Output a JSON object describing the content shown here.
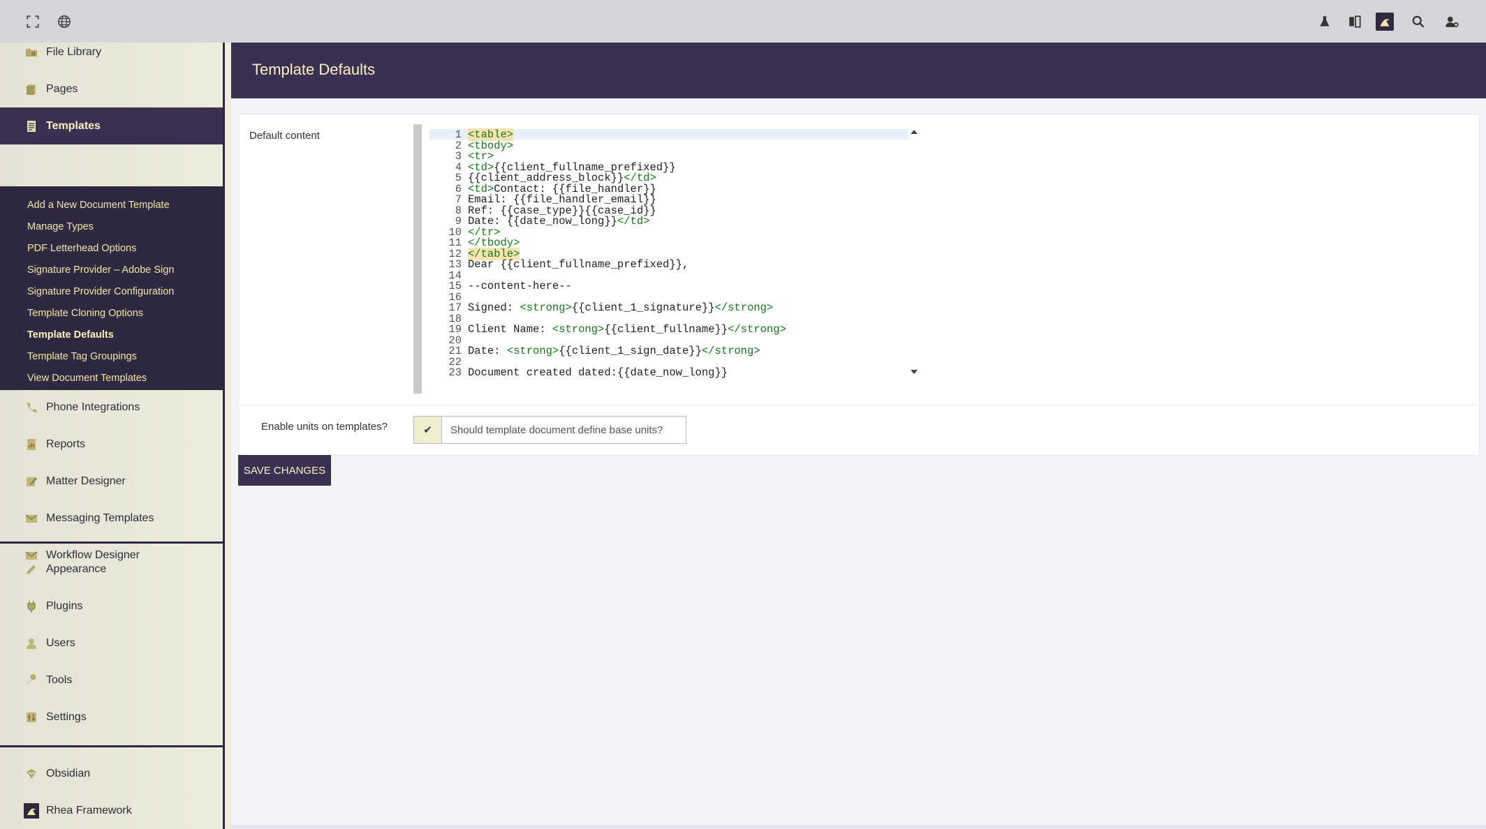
{
  "page_title": "Template Defaults",
  "topbar": {
    "left_icons": [
      "fullscreen-icon",
      "globe-icon"
    ],
    "right_icons": [
      "flask-icon",
      "book-icon",
      "rhea-logo-icon",
      "search-icon",
      "user-settings-icon"
    ]
  },
  "sidebar": {
    "items_top": [
      {
        "label": "File Library",
        "icon": "folder-icon"
      },
      {
        "label": "Pages",
        "icon": "pages-icon"
      },
      {
        "label": "Templates",
        "icon": "document-icon"
      }
    ],
    "submenu": [
      "Add a New Document Template",
      "Manage Types",
      "PDF Letterhead Options",
      "Signature Provider – Adobe Sign",
      "Signature Provider Configuration",
      "Template Cloning Options",
      "Template Defaults",
      "Template Tag Groupings",
      "View Document Templates"
    ],
    "items_mid": [
      {
        "label": "Phone Integrations",
        "icon": "phone-icon"
      },
      {
        "label": "Reports",
        "icon": "report-icon"
      },
      {
        "label": "Matter Designer",
        "icon": "edit-icon"
      },
      {
        "label": "Messaging Templates",
        "icon": "mail-icon"
      },
      {
        "label": "Workflow Designer",
        "icon": "mail-icon"
      }
    ],
    "items_admin": [
      {
        "label": "Appearance",
        "icon": "brush-icon"
      },
      {
        "label": "Plugins",
        "icon": "plug-icon"
      },
      {
        "label": "Users",
        "icon": "user-icon"
      },
      {
        "label": "Tools",
        "icon": "wrench-icon"
      },
      {
        "label": "Settings",
        "icon": "sliders-icon"
      }
    ],
    "items_bottom": [
      {
        "label": "Obsidian",
        "icon": "obsidian-icon"
      },
      {
        "label": "Rhea Framework",
        "icon": "rhea-logo-icon"
      }
    ]
  },
  "form": {
    "default_content_label": "Default content",
    "code_lines": [
      [
        {
          "t": "<table>",
          "c": "tag match"
        }
      ],
      [
        {
          "t": "<tbody>",
          "c": "tag"
        }
      ],
      [
        {
          "t": "<tr>",
          "c": "tag"
        }
      ],
      [
        {
          "t": "<td>",
          "c": "tag"
        },
        {
          "t": "{{client_fullname_prefixed}}"
        }
      ],
      [
        {
          "t": "{{client_address_block}}"
        },
        {
          "t": "</td>",
          "c": "tag"
        }
      ],
      [
        {
          "t": "<td>",
          "c": "tag"
        },
        {
          "t": "Contact: {{file_handler}}"
        }
      ],
      [
        {
          "t": "Email: {{file_handler_email}}"
        }
      ],
      [
        {
          "t": "Ref: {{case_type}}{{case_id}}"
        }
      ],
      [
        {
          "t": "Date: {{date_now_long}}"
        },
        {
          "t": "</td>",
          "c": "tag"
        }
      ],
      [
        {
          "t": "</tr>",
          "c": "tag"
        }
      ],
      [
        {
          "t": "</tbody>",
          "c": "tag"
        }
      ],
      [
        {
          "t": "</table>",
          "c": "tag match"
        }
      ],
      [
        {
          "t": "Dear {{client_fullname_prefixed}},"
        }
      ],
      [],
      [
        {
          "t": "--content-here--"
        }
      ],
      [],
      [
        {
          "t": "Signed: "
        },
        {
          "t": "<strong>",
          "c": "tag"
        },
        {
          "t": "{{client_1_signature}}"
        },
        {
          "t": "</strong>",
          "c": "tag"
        }
      ],
      [],
      [
        {
          "t": "Client Name: "
        },
        {
          "t": "<strong>",
          "c": "tag"
        },
        {
          "t": "{{client_fullname}}"
        },
        {
          "t": "</strong>",
          "c": "tag"
        }
      ],
      [],
      [
        {
          "t": "Date: "
        },
        {
          "t": "<strong>",
          "c": "tag"
        },
        {
          "t": "{{client_1_sign_date}}"
        },
        {
          "t": "</strong>",
          "c": "tag"
        }
      ],
      [],
      [
        {
          "t": "Document created dated:{{date_now_long}}"
        }
      ]
    ],
    "units_label": "Enable units on templates?",
    "units_toggle_checked": true,
    "units_toggle_mark": "✔",
    "units_toggle_text": "Should template document define base units?",
    "save_label": "SAVE CHANGES"
  },
  "colors": {
    "accent": "#3a3152",
    "accent_text": "#fff2c5",
    "sidebar_bg": "#e8e7d8",
    "code_tag": "#117a17"
  }
}
